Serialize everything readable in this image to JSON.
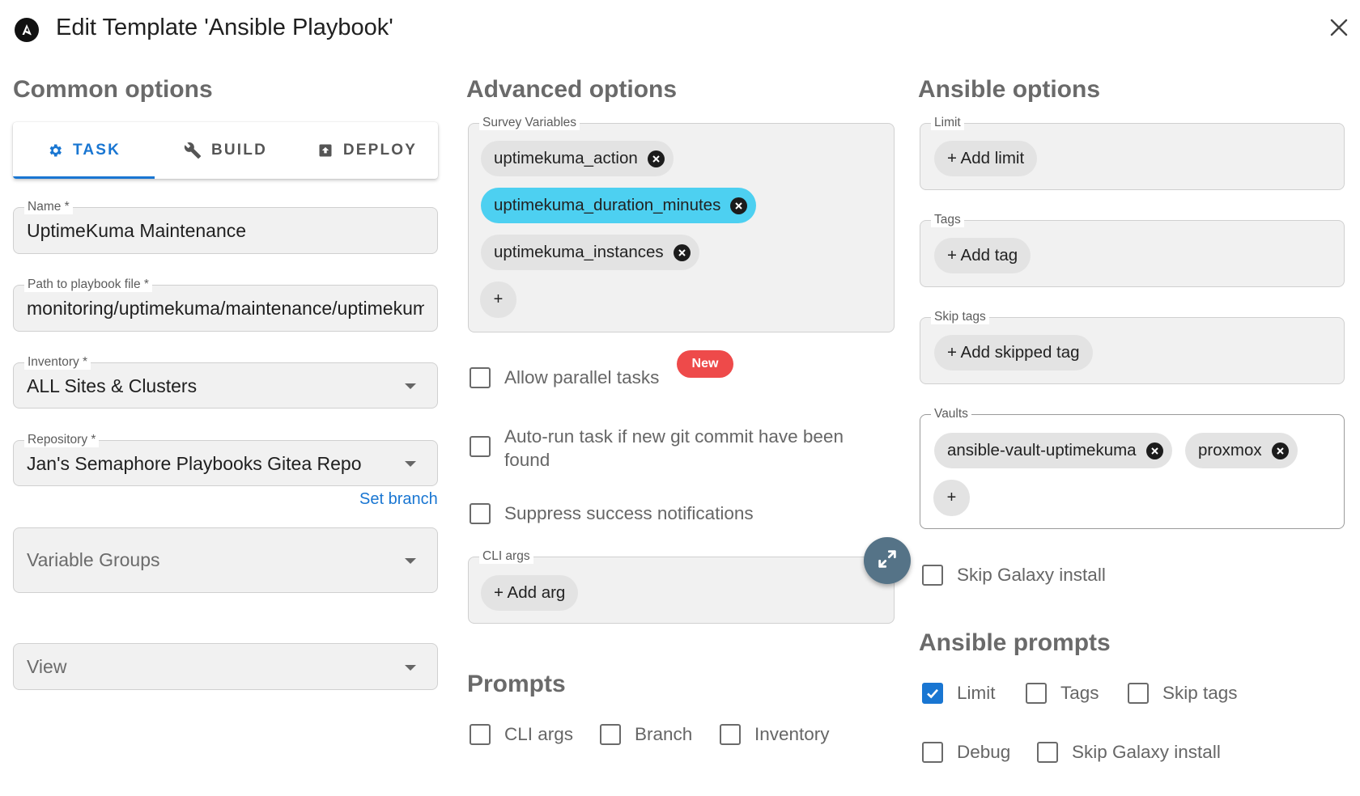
{
  "header": {
    "title": "Edit Template 'Ansible Playbook'"
  },
  "sections": {
    "common": "Common options",
    "advanced": "Advanced options",
    "ansible": "Ansible options",
    "prompts": "Prompts",
    "ansible_prompts": "Ansible prompts"
  },
  "tabs": [
    {
      "label": "TASK",
      "icon": "gear-icon",
      "active": true
    },
    {
      "label": "BUILD",
      "icon": "wrench-icon",
      "active": false
    },
    {
      "label": "DEPLOY",
      "icon": "upload-box-icon",
      "active": false
    }
  ],
  "common": {
    "name": {
      "label": "Name *",
      "value": "UptimeKuma Maintenance"
    },
    "playbook": {
      "label": "Path to playbook file *",
      "value": "monitoring/uptimekuma/maintenance/uptimekuma"
    },
    "inventory": {
      "label": "Inventory *",
      "value": "ALL Sites & Clusters"
    },
    "repository": {
      "label": "Repository *",
      "value": "Jan's Semaphore Playbooks Gitea Repo"
    },
    "set_branch": "Set branch",
    "variable_groups": {
      "placeholder": "Variable Groups"
    },
    "view": {
      "placeholder": "View"
    }
  },
  "advanced": {
    "survey_label": "Survey Variables",
    "survey_vars": [
      {
        "label": "uptimekuma_action",
        "highlight": false
      },
      {
        "label": "uptimekuma_duration_minutes",
        "highlight": true
      },
      {
        "label": "uptimekuma_instances",
        "highlight": false
      }
    ],
    "plus": "+",
    "allow_parallel": "Allow parallel tasks",
    "new_badge": "New",
    "autorun": "Auto-run task if new git commit have been found",
    "suppress": "Suppress success notifications",
    "cli_args_label": "CLI args",
    "add_arg": "+ Add arg"
  },
  "prompts": {
    "cli_args": "CLI args",
    "branch": "Branch",
    "inventory": "Inventory"
  },
  "ansible": {
    "limit_label": "Limit",
    "add_limit": "+ Add limit",
    "tags_label": "Tags",
    "add_tag": "+ Add tag",
    "skip_tags_label": "Skip tags",
    "add_skipped_tag": "+ Add skipped tag",
    "vaults_label": "Vaults",
    "vaults": [
      "ansible-vault-uptimekuma",
      "proxmox"
    ],
    "plus": "+",
    "skip_galaxy": "Skip Galaxy install"
  },
  "ansible_prompts": {
    "limit": "Limit",
    "tags": "Tags",
    "skip_tags": "Skip tags",
    "debug": "Debug",
    "skip_galaxy": "Skip Galaxy install"
  },
  "colors": {
    "accent": "#1976d2",
    "highlight_chip": "#4dd0f1",
    "badge": "#ee4a4a",
    "fab": "#557387"
  }
}
